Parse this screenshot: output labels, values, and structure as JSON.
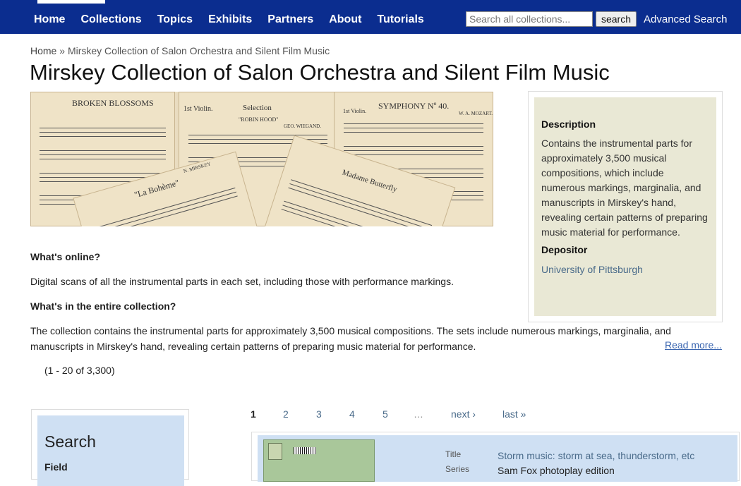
{
  "nav": {
    "items": [
      "Home",
      "Collections",
      "Topics",
      "Exhibits",
      "Partners",
      "About",
      "Tutorials"
    ],
    "search_placeholder": "Search all collections...",
    "search_button": "search",
    "advanced_search": "Advanced Search"
  },
  "breadcrumb": {
    "home": "Home",
    "separator": "»",
    "current": "Mirskey Collection of Salon Orchestra and Silent Film Music"
  },
  "page_title": "Mirskey Collection of Salon Orchestra and Silent Film Music",
  "banner": {
    "sheets": [
      "BROKEN BLOSSOMS",
      "Selection",
      "SYMPHONY Nº 40.",
      "\"La Bohème\"",
      "Madame Butterfly",
      "N. MIRSKEY",
      "1st Violin.",
      "GEO. WIEGAND.",
      "W. A. MOZART.",
      "\"ROBIN HOOD\"",
      "1st Violin."
    ]
  },
  "description": {
    "heading": "Description",
    "text": "Contains the instrumental parts for approximately 3,500 musical compositions, which include numerous markings, marginalia, and manuscripts in Mirskey's hand, revealing certain patterns of preparing music material for performance.",
    "depositor_heading": "Depositor",
    "depositor": "University of Pittsburgh"
  },
  "main": {
    "online_heading": "What's online?",
    "online_text": "Digital scans of all the instrumental parts in each set, including those with performance markings.",
    "entire_heading": "What's in the entire collection?",
    "entire_text": "The collection contains the instrumental parts for approximately 3,500 musical compositions. The sets include numerous markings, marginalia, and manuscripts in Mirskey's hand, revealing certain patterns of preparing music material for performance.",
    "read_more": "Read more...",
    "count": "(1 - 20 of 3,300)"
  },
  "search_panel": {
    "title": "Search",
    "field_label": "Field"
  },
  "pager": {
    "pages": [
      "1",
      "2",
      "3",
      "4",
      "5",
      "…"
    ],
    "next": "next ›",
    "last": "last »"
  },
  "result": {
    "title_label": "Title",
    "title": "Storm music: storm at sea, thunderstorm, etc",
    "series_label": "Series",
    "series": "Sam Fox photoplay edition"
  }
}
